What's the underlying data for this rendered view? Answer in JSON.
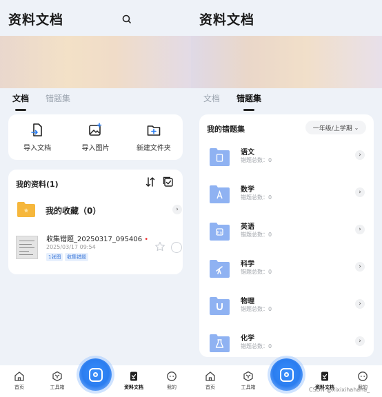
{
  "left": {
    "app_title": "资料文档",
    "tabs": [
      {
        "label": "文档",
        "active": true
      },
      {
        "label": "错题集",
        "active": false
      }
    ],
    "actions": [
      {
        "label": "导入文档",
        "icon": "import-document-icon"
      },
      {
        "label": "导入图片",
        "icon": "import-image-icon"
      },
      {
        "label": "新建文件夹",
        "icon": "new-folder-icon"
      }
    ],
    "my_docs": {
      "title": "我的资料(1)",
      "favorites": "我的收藏（0）",
      "doc": {
        "name": "收集错题_20250317_095406",
        "date": "2025/03/17 09:54",
        "tags": [
          "1张图",
          "收集错题"
        ]
      }
    }
  },
  "right": {
    "app_title": "资料文档",
    "tabs": [
      {
        "label": "文档",
        "active": false
      },
      {
        "label": "错题集",
        "active": true
      }
    ],
    "my_errors": {
      "title": "我的错题集",
      "grade": "一年级/上学期",
      "subjects": [
        {
          "name": "语文",
          "count": "错题总数：0",
          "icon": "book-icon"
        },
        {
          "name": "数学",
          "count": "错题总数：0",
          "icon": "math-icon"
        },
        {
          "name": "英语",
          "count": "错题总数：0",
          "icon": "english-icon"
        },
        {
          "name": "科学",
          "count": "错题总数：0",
          "icon": "telescope-icon"
        },
        {
          "name": "物理",
          "count": "错题总数：0",
          "icon": "magnet-icon"
        },
        {
          "name": "化学",
          "count": "错题总数：0",
          "icon": "flask-icon"
        }
      ]
    }
  },
  "nav": {
    "items": [
      {
        "label": "首页",
        "icon": "home-icon"
      },
      {
        "label": "工具箱",
        "icon": "toolbox-icon"
      },
      {
        "label": "资料文档",
        "icon": "document-icon",
        "active": true
      },
      {
        "label": "我的",
        "icon": "profile-icon"
      }
    ]
  },
  "watermark": "CSDN @xixixihahaha_",
  "colors": {
    "accent": "#2a7df0",
    "folder": "#f6b73c",
    "subject_icon": "#8fb2f2",
    "tag": "#3a76d8"
  }
}
